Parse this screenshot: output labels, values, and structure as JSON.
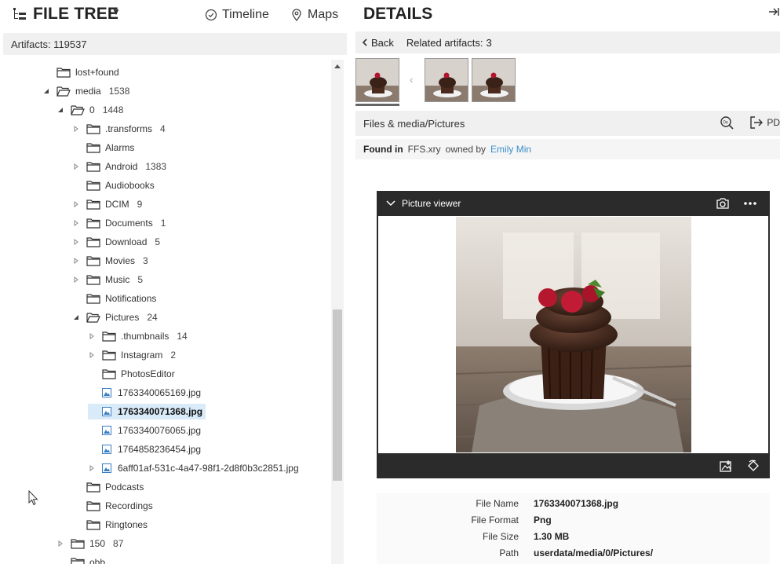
{
  "left": {
    "title": "FILE TREE",
    "nav": {
      "timeline": "Timeline",
      "maps": "Maps"
    },
    "artifacts_label": "Artifacts: 119537"
  },
  "tree": [
    {
      "label": "lost+found",
      "count": "",
      "twisty": "none",
      "icon": "folder"
    },
    {
      "label": "media",
      "count": "1538",
      "twisty": "expanded",
      "icon": "folder-open"
    },
    {
      "label": "0",
      "count": "1448",
      "twisty": "expanded",
      "icon": "folder-open"
    },
    {
      "label": ".transforms",
      "count": "4",
      "twisty": "collapsed",
      "icon": "folder"
    },
    {
      "label": "Alarms",
      "count": "",
      "twisty": "none",
      "icon": "folder"
    },
    {
      "label": "Android",
      "count": "1383",
      "twisty": "collapsed",
      "icon": "folder"
    },
    {
      "label": "Audiobooks",
      "count": "",
      "twisty": "none",
      "icon": "folder"
    },
    {
      "label": "DCIM",
      "count": "9",
      "twisty": "collapsed",
      "icon": "folder"
    },
    {
      "label": "Documents",
      "count": "1",
      "twisty": "collapsed",
      "icon": "folder"
    },
    {
      "label": "Download",
      "count": "5",
      "twisty": "collapsed",
      "icon": "folder"
    },
    {
      "label": "Movies",
      "count": "3",
      "twisty": "collapsed",
      "icon": "folder"
    },
    {
      "label": "Music",
      "count": "5",
      "twisty": "collapsed",
      "icon": "folder"
    },
    {
      "label": "Notifications",
      "count": "",
      "twisty": "none",
      "icon": "folder"
    },
    {
      "label": "Pictures",
      "count": "24",
      "twisty": "expanded",
      "icon": "folder-open"
    },
    {
      "label": ".thumbnails",
      "count": "14",
      "twisty": "collapsed",
      "icon": "folder"
    },
    {
      "label": "Instagram",
      "count": "2",
      "twisty": "collapsed",
      "icon": "folder"
    },
    {
      "label": "PhotosEditor",
      "count": "",
      "twisty": "none",
      "icon": "folder"
    },
    {
      "label": "1763340065169.jpg",
      "count": "",
      "twisty": "none",
      "icon": "image"
    },
    {
      "label": "1763340071368.jpg",
      "count": "",
      "twisty": "none",
      "icon": "image",
      "selected": true
    },
    {
      "label": "1763340076065.jpg",
      "count": "",
      "twisty": "none",
      "icon": "image"
    },
    {
      "label": "1764858236454.jpg",
      "count": "",
      "twisty": "none",
      "icon": "image"
    },
    {
      "label": "6aff01af-531c-4a47-98f1-2d8f0b3c2851.jpg",
      "count": "",
      "twisty": "collapsed",
      "icon": "image"
    },
    {
      "label": "Podcasts",
      "count": "",
      "twisty": "none",
      "icon": "folder"
    },
    {
      "label": "Recordings",
      "count": "",
      "twisty": "none",
      "icon": "folder"
    },
    {
      "label": "Ringtones",
      "count": "",
      "twisty": "none",
      "icon": "folder"
    },
    {
      "label": "150",
      "count": "87",
      "twisty": "collapsed",
      "icon": "folder"
    },
    {
      "label": "obb",
      "count": "",
      "twisty": "none",
      "icon": "folder"
    }
  ],
  "details": {
    "title": "DETAILS",
    "back": "Back",
    "related_label": "Related artifacts:",
    "related_count": "3",
    "path": "Files & media/Pictures",
    "pdf_label": "PD",
    "found_in_label": "Found in",
    "found_in_value": "FFS.xry",
    "owned_by": "owned by",
    "owner": "Emily Min",
    "viewer_title": "Picture viewer",
    "props": [
      {
        "k": "File Name",
        "v": "1763340071368.jpg"
      },
      {
        "k": "File Format",
        "v": "Png"
      },
      {
        "k": "File Size",
        "v": "1.30 MB"
      },
      {
        "k": "Path",
        "v": "userdata/media/0/Pictures/"
      }
    ]
  },
  "colors": {
    "accent_link": "#3a8fc9",
    "selected_row": "#d9ebf9",
    "viewer_frame": "#2b2b2b"
  }
}
